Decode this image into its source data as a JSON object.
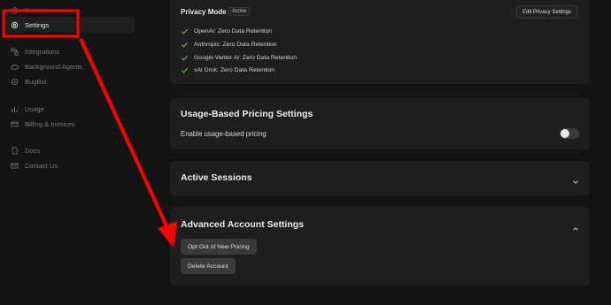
{
  "sidebar": {
    "items": [
      {
        "label": "Overview",
        "icon": "home-icon"
      },
      {
        "label": "Settings",
        "icon": "gear-icon"
      },
      {
        "label": "Integrations",
        "icon": "integrations-icon"
      },
      {
        "label": "Background Agents",
        "icon": "cloud-icon"
      },
      {
        "label": "BugBot",
        "icon": "bug-icon"
      },
      {
        "label": "Usage",
        "icon": "bar-chart-icon"
      },
      {
        "label": "Billing & Invoices",
        "icon": "credit-card-icon"
      },
      {
        "label": "Docs",
        "icon": "document-icon"
      },
      {
        "label": "Contact Us",
        "icon": "mail-icon"
      }
    ]
  },
  "privacy": {
    "title": "Privacy Mode",
    "status": "Active",
    "edit_label": "Edit Privacy Settings",
    "providers": [
      "OpenAI: Zero Data Retention",
      "Anthropic: Zero Data Retention",
      "Google Vertex AI: Zero Data Retention",
      "xAi Grok: Zero Data Retention"
    ]
  },
  "usage_pricing": {
    "title": "Usage-Based Pricing Settings",
    "toggle_label": "Enable usage-based pricing",
    "enabled": false
  },
  "active_sessions": {
    "title": "Active Sessions"
  },
  "advanced": {
    "title": "Advanced Account Settings",
    "opt_out_label": "Opt Out of New Pricing",
    "delete_label": "Delete Account"
  },
  "colors": {
    "highlight": "#ff0000",
    "check": "#6bbf4e"
  }
}
